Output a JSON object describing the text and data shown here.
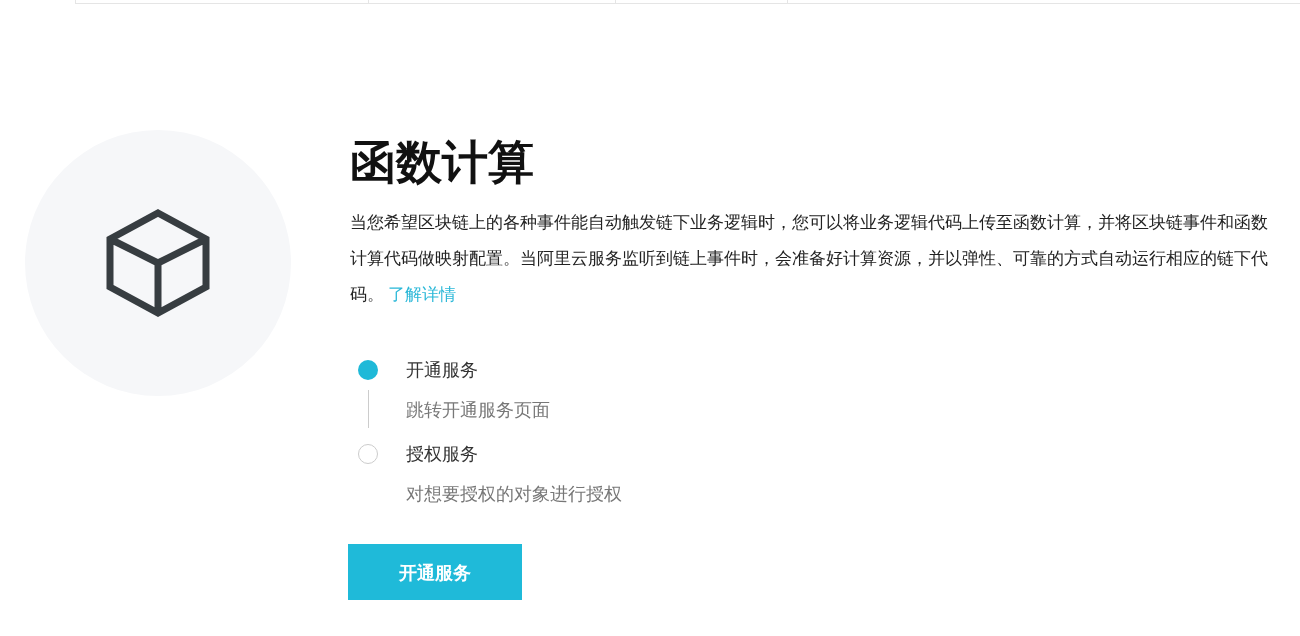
{
  "title": "函数计算",
  "description": "当您希望区块链上的各种事件能自动触发链下业务逻辑时，您可以将业务逻辑代码上传至函数计算，并将区块链事件和函数计算代码做映射配置。当阿里云服务监听到链上事件时，会准备好计算资源，并以弹性、可靠的方式自动运行相应的链下代码。",
  "link": "了解详情",
  "steps": [
    {
      "title": "开通服务",
      "description": "跳转开通服务页面",
      "selected": true
    },
    {
      "title": "授权服务",
      "description": "对想要授权的对象进行授权",
      "selected": false
    }
  ],
  "button": "开通服务"
}
